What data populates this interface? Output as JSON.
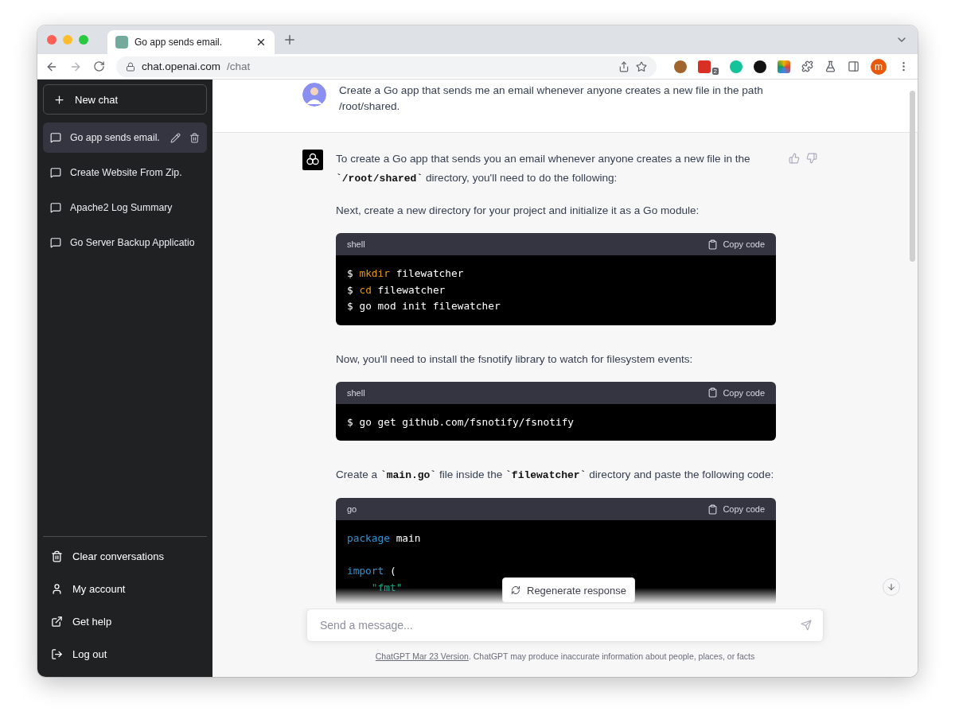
{
  "browser": {
    "tab": {
      "title": "Go app sends email."
    },
    "url": {
      "host": "chat.openai.com",
      "path": "/chat"
    },
    "extension_badge": "2",
    "profile_initial": "m"
  },
  "sidebar": {
    "new_chat": "New chat",
    "conversations": [
      {
        "title": "Go app sends email.",
        "selected": true
      },
      {
        "title": "Create Website From Zip.",
        "selected": false
      },
      {
        "title": "Apache2 Log Summary",
        "selected": false
      },
      {
        "title": "Go Server Backup Applicatio",
        "selected": false
      }
    ],
    "menu": [
      {
        "kind": "trash",
        "label": "Clear conversations"
      },
      {
        "kind": "user",
        "label": "My account"
      },
      {
        "kind": "external",
        "label": "Get help"
      },
      {
        "kind": "logout",
        "label": "Log out"
      }
    ]
  },
  "messages": [
    {
      "kind": "user",
      "blocks": [
        {
          "kind": "text",
          "parts": [
            {
              "kind": "text",
              "s": "Create a Go app that sends me an email whenever anyone creates a new file in the path /root/shared."
            }
          ]
        }
      ]
    },
    {
      "kind": "assistant",
      "blocks": [
        {
          "kind": "text",
          "parts": [
            {
              "kind": "text",
              "s": "To create a Go app that sends you an email whenever anyone creates a new file in the "
            },
            {
              "kind": "code",
              "s": "`/root/shared`"
            },
            {
              "kind": "text",
              "s": " directory, you'll need to do the following:"
            }
          ]
        },
        {
          "kind": "text",
          "parts": [
            {
              "kind": "text",
              "s": "Next, create a new directory for your project and initialize it as a Go module:"
            }
          ]
        },
        {
          "kind": "code",
          "language": "shell",
          "copy_label": "Copy code",
          "lines": [
            {
              "tokens": [
                {
                  "kind": "prompt",
                  "s": "$ "
                },
                {
                  "kind": "command",
                  "s": "mkdir"
                },
                {
                  "kind": "plain",
                  "s": " filewatcher"
                }
              ]
            },
            {
              "tokens": [
                {
                  "kind": "prompt",
                  "s": "$ "
                },
                {
                  "kind": "command",
                  "s": "cd"
                },
                {
                  "kind": "plain",
                  "s": " filewatcher"
                }
              ]
            },
            {
              "tokens": [
                {
                  "kind": "prompt",
                  "s": "$ "
                },
                {
                  "kind": "plain",
                  "s": "go mod init filewatcher"
                }
              ]
            }
          ]
        },
        {
          "kind": "text",
          "parts": [
            {
              "kind": "text",
              "s": "Now, you'll need to install the fsnotify library to watch for filesystem events:"
            }
          ]
        },
        {
          "kind": "code",
          "language": "shell",
          "copy_label": "Copy code",
          "lines": [
            {
              "tokens": [
                {
                  "kind": "prompt",
                  "s": "$ "
                },
                {
                  "kind": "plain",
                  "s": "go get github.com/fsnotify/fsnotify"
                }
              ]
            }
          ]
        },
        {
          "kind": "text",
          "parts": [
            {
              "kind": "text",
              "s": "Create a "
            },
            {
              "kind": "code",
              "s": "`main.go`"
            },
            {
              "kind": "text",
              "s": " file inside the "
            },
            {
              "kind": "code",
              "s": "`filewatcher`"
            },
            {
              "kind": "text",
              "s": " directory and paste the following code:"
            }
          ]
        },
        {
          "kind": "code",
          "language": "go",
          "copy_label": "Copy code",
          "lines": [
            {
              "kind": "code",
              "tokens": [
                {
                  "kind": "keyword",
                  "s": "package"
                },
                {
                  "kind": "plain",
                  "s": " main"
                }
              ]
            },
            {
              "kind": "blank"
            },
            {
              "kind": "code",
              "tokens": [
                {
                  "kind": "keyword",
                  "s": "import"
                },
                {
                  "kind": "plain",
                  "s": " ("
                }
              ]
            },
            {
              "kind": "code",
              "tokens": [
                {
                  "kind": "string",
                  "s": "    \"fmt\""
                }
              ]
            }
          ]
        }
      ]
    }
  ],
  "regenerate": "Regenerate response",
  "composer": {
    "placeholder": "Send a message..."
  },
  "footer": {
    "link": "ChatGPT Mar 23 Version",
    "text": ". ChatGPT may produce inaccurate information about people, places, or facts"
  }
}
